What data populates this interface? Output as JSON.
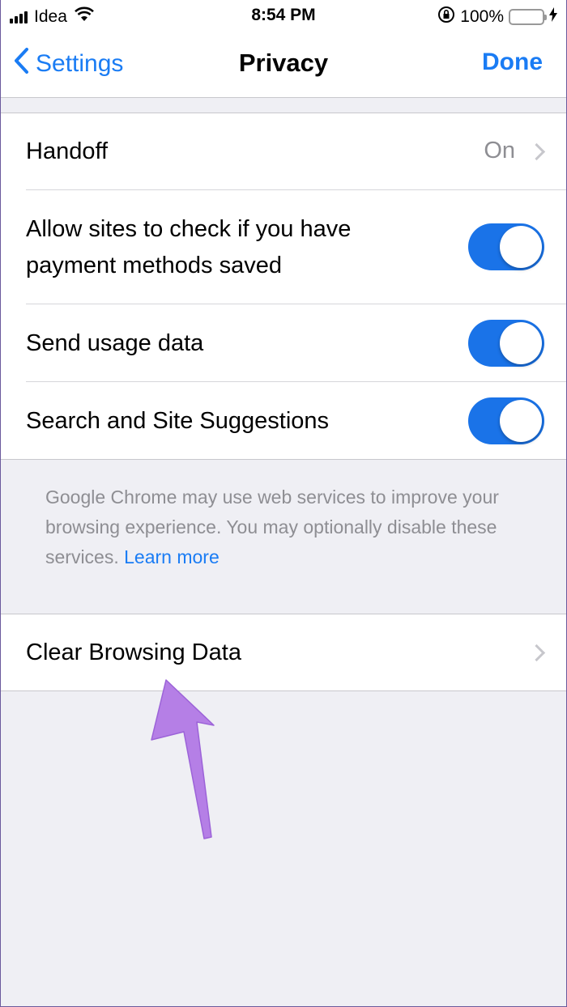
{
  "status": {
    "carrier": "Idea",
    "time": "8:54 PM",
    "battery": "100%",
    "battery_level": 1.0
  },
  "nav": {
    "back_label": "Settings",
    "title": "Privacy",
    "done_label": "Done"
  },
  "settings": {
    "handoff": {
      "label": "Handoff",
      "value": "On"
    },
    "payment": {
      "label_line1": "Allow sites to check if you have",
      "label_line2": "payment methods saved",
      "enabled": true
    },
    "usage": {
      "label": "Send usage data",
      "enabled": true
    },
    "suggestions": {
      "label": "Search and Site Suggestions",
      "enabled": true
    }
  },
  "footer": {
    "text": "Google Chrome may use web services to improve your browsing experience. You may optionally disable these services.",
    "link": "Learn more"
  },
  "clear": {
    "label": "Clear Browsing Data"
  },
  "colors": {
    "accent": "#1a7cf4",
    "toggle_on": "#1a73e8",
    "arrow": "#b57fe6"
  }
}
